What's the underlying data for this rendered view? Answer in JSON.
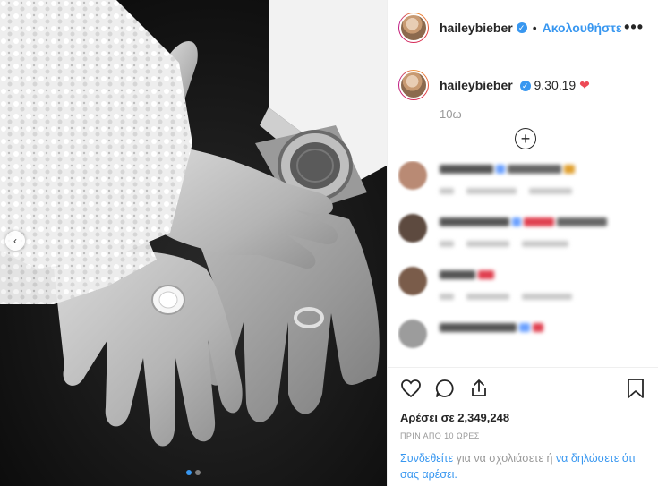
{
  "post": {
    "username": "haileybieber",
    "follow_label": "Ακολουθήστε",
    "more_label": "•••",
    "caption": "9.30.19",
    "caption_emoji": "❤",
    "age": "10ω",
    "load_more": "+"
  },
  "image": {
    "alt": "Black and white photo of two hands with rings and a watch"
  },
  "comments": [
    {
      "avatar_color": "#b98a74"
    },
    {
      "avatar_color": "#5d4a3f"
    },
    {
      "avatar_color": "#7a5c4a"
    },
    {
      "avatar_color": "#9c9c9c"
    }
  ],
  "actions": {
    "likes_label": "Αρέσει σε 2,349,248",
    "time_label": "ΠΡΙΝ ΑΠΟ 10 ΩΡΕΣ"
  },
  "login": {
    "link": "Συνδεθείτε",
    "text1": " για να σχολιάσετε ή ",
    "text2": "να δηλώσετε ότι σας αρέσει."
  },
  "carousel": {
    "current": 1,
    "total": 2
  },
  "colors": {
    "accent": "#3897f0",
    "heart": "#ed4956"
  }
}
